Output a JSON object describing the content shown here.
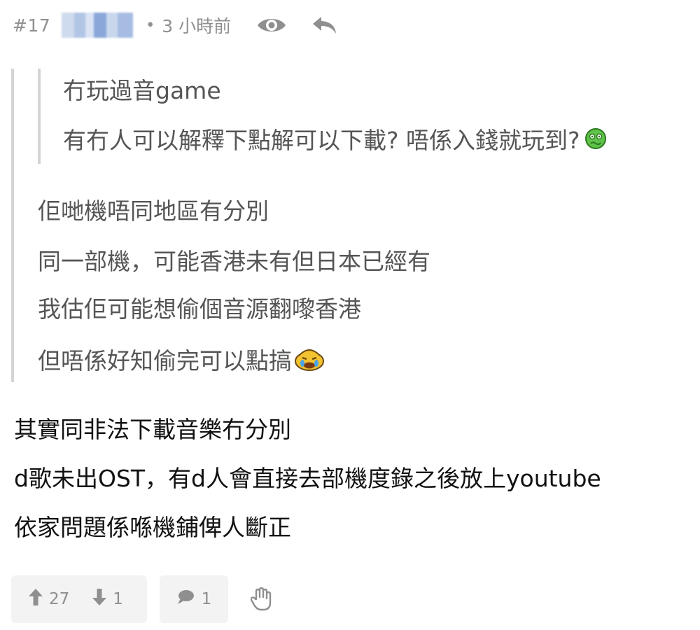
{
  "post": {
    "number": "#17",
    "separator": "•",
    "time": "3 小時前"
  },
  "icons": {
    "view": "eye-icon",
    "reply": "reply-arrow-icon",
    "upvote": "arrow-up-icon",
    "downvote": "arrow-down-icon",
    "comment": "comment-icon",
    "report": "hand-stop-icon",
    "emoji_sick": "green-sick-emoji-icon",
    "emoji_cry": "crying-emoji-icon"
  },
  "quote_nested": {
    "lines": [
      "冇玩過音game",
      "有冇人可以解釋下點解可以下載? 唔係入錢就玩到?"
    ]
  },
  "quote": {
    "lines": [
      "佢哋機唔同地區有分別",
      "同一部機，可能香港未有但日本已經有",
      "我估佢可能想偷個音源翻嚟香港",
      "但唔係好知偷完可以點搞"
    ]
  },
  "body": {
    "lines": [
      "其實同非法下載音樂冇分別",
      "d歌未出OST，有d人會直接去部機度錄之後放上youtube",
      "依家問題係喺機鋪俾人斷正"
    ]
  },
  "actions": {
    "upvotes": "27",
    "downvotes": "1",
    "comments": "1"
  },
  "colors": {
    "meta_text": "#8f8f8f",
    "quote_border": "#d4d4d4",
    "action_bg": "#f3f3f3"
  }
}
